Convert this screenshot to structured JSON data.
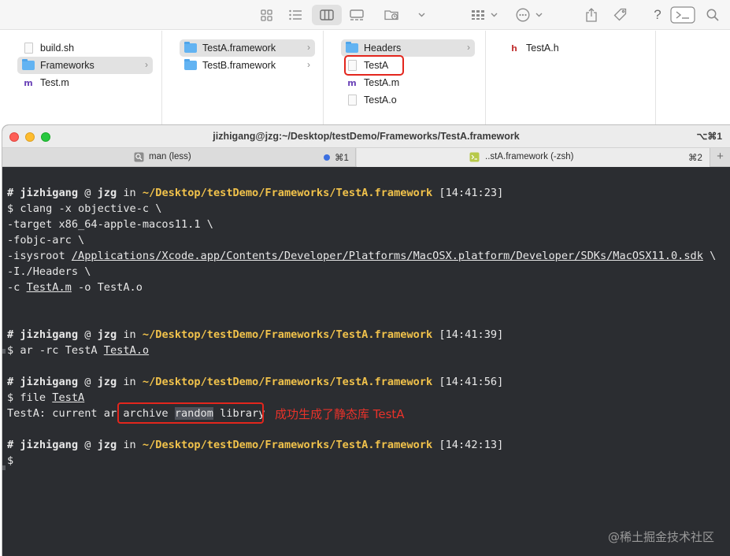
{
  "finder": {
    "toolbar_icons": [
      "grid-view-icon",
      "list-view-icon",
      "column-view-icon",
      "gallery-view-icon",
      "folder-action-icon",
      "chevron-down-icon",
      "group-icon",
      "chevron-down-icon",
      "action-menu-icon",
      "chevron-down-icon",
      "share-icon",
      "tag-icon",
      "help-icon",
      "terminal-icon",
      "search-icon"
    ],
    "help_label": "?",
    "columns": [
      {
        "items": [
          {
            "name": "build.sh",
            "icon": "file-icon"
          },
          {
            "name": "Frameworks",
            "icon": "folder-icon",
            "selected": true,
            "chevron": true
          },
          {
            "name": "Test.m",
            "icon": "m-file-icon"
          }
        ]
      },
      {
        "items": [
          {
            "name": "TestA.framework",
            "icon": "folder-icon",
            "selected": true,
            "chevron": true
          },
          {
            "name": "TestB.framework",
            "icon": "folder-icon",
            "chevron": true
          }
        ]
      },
      {
        "items": [
          {
            "name": "Headers",
            "icon": "folder-icon",
            "selected": true,
            "chevron": true
          },
          {
            "name": "TestA",
            "icon": "file-icon",
            "highlighted": true
          },
          {
            "name": "TestA.m",
            "icon": "m-file-icon"
          },
          {
            "name": "TestA.o",
            "icon": "file-icon"
          }
        ]
      },
      {
        "items": [
          {
            "name": "TestA.h",
            "icon": "h-file-icon"
          }
        ]
      }
    ],
    "m_glyph": "m",
    "h_glyph": "h",
    "chevron_glyph": "›"
  },
  "terminal": {
    "title": "jizhigang@jzg:~/Desktop/testDemo/Frameworks/TestA.framework",
    "title_shortcut": "⌥⌘1",
    "tabs": [
      {
        "label": "man (less)",
        "shortcut": "⌘1",
        "icon": "magnifier-icon",
        "dot_color": "#3b6fe0"
      },
      {
        "label": "..stA.framework (-zsh)",
        "shortcut": "⌘2",
        "icon": "terminal-tab-icon"
      }
    ],
    "plus": "+",
    "prompt": {
      "hash": "#",
      "user": "jizhigang",
      "at": "@",
      "host": "jzg",
      "in": "in",
      "dir": "~/Desktop/testDemo/Frameworks/TestA.framework"
    },
    "times": [
      "[14:41:23]",
      "[14:41:39]",
      "[14:41:56]",
      "[14:42:13]"
    ],
    "dollar": "$",
    "cmd1": {
      "line1": "clang -x objective-c \\",
      "line2": "-target x86_64-apple-macos11.1 \\",
      "line3": "-fobjc-arc \\",
      "line4_prefix": "-isysroot ",
      "line4_path": "/Applications/Xcode.app/Contents/Developer/Platforms/MacOSX.platform/Developer/SDKs/MacOSX11.0.sdk",
      "line4_suffix": " \\",
      "line5": "-I./Headers \\",
      "line6_prefix": "-c ",
      "line6_file": "TestA.m",
      "line6_suffix": " -o TestA.o"
    },
    "cmd2": {
      "prefix": "ar -rc TestA ",
      "file": "TestA.o"
    },
    "cmd3": {
      "prefix": "file ",
      "file": "TestA"
    },
    "output": {
      "prefix": "TestA: current ar ",
      "w1": "archive",
      "w2": "random",
      "w3": "library"
    },
    "annotation": "成功生成了静态库 TestA",
    "watermark": "@稀土掘金技术社区"
  }
}
